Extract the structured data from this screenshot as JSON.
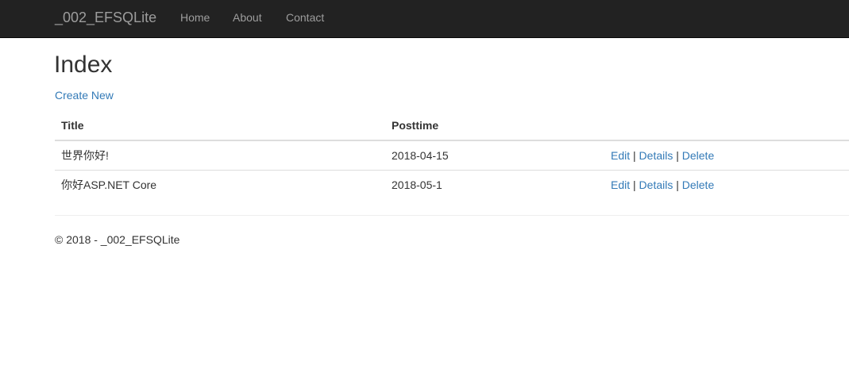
{
  "navbar": {
    "brand": "_002_EFSQLite",
    "items": [
      {
        "label": "Home"
      },
      {
        "label": "About"
      },
      {
        "label": "Contact"
      }
    ]
  },
  "main": {
    "title": "Index",
    "create_link": "Create New",
    "table": {
      "headers": {
        "title": "Title",
        "posttime": "Posttime",
        "actions": ""
      },
      "rows": [
        {
          "title": "世界你好!",
          "posttime": "2018-04-15",
          "edit": "Edit",
          "details": "Details",
          "delete": "Delete"
        },
        {
          "title": "你好ASP.NET Core",
          "posttime": "2018-05-1",
          "edit": "Edit",
          "details": "Details",
          "delete": "Delete"
        }
      ],
      "separator": "|"
    }
  },
  "footer": {
    "text": "© 2018 - _002_EFSQLite"
  },
  "colors": {
    "navbar_bg": "#222222",
    "nav_text": "#9d9d9d",
    "link": "#337ab7",
    "text": "#333333"
  }
}
